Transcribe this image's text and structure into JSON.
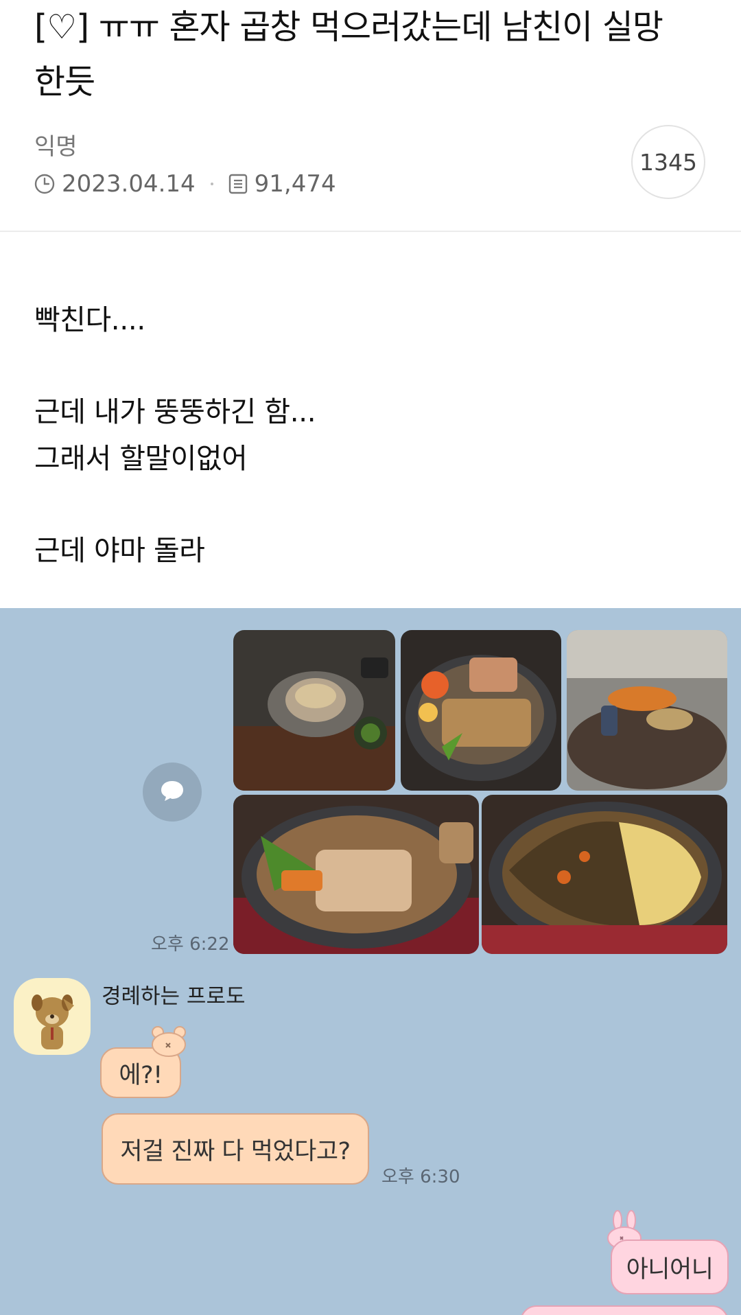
{
  "post": {
    "title": "[♡] ㅠㅠ 혼자 곱창 먹으러갔는데 남친이 실망한듯",
    "author": "익명",
    "date": "2023.04.14",
    "views": "91,474",
    "comment_count": "1345"
  },
  "body": {
    "lines": [
      "빡친다....",
      "근데 내가 뚱뚱하긴 함...",
      "그래서 할말이없어",
      "근데 야마 돌라"
    ]
  },
  "chat": {
    "sent_time": "오후 6:22",
    "sender_name": "경례하는 프로도",
    "messages": [
      "에?!",
      "저걸 진짜 다 먹었다고?"
    ],
    "reply_time": "오후 6:30",
    "my_reply": "아니어니"
  },
  "colors": {
    "chat_background": "#abc4d9",
    "friend_bubble": "#ffd9b8",
    "my_bubble": "#ffd5e0"
  },
  "icons": [
    "clock-icon",
    "document-icon",
    "share-bubble-icon"
  ]
}
